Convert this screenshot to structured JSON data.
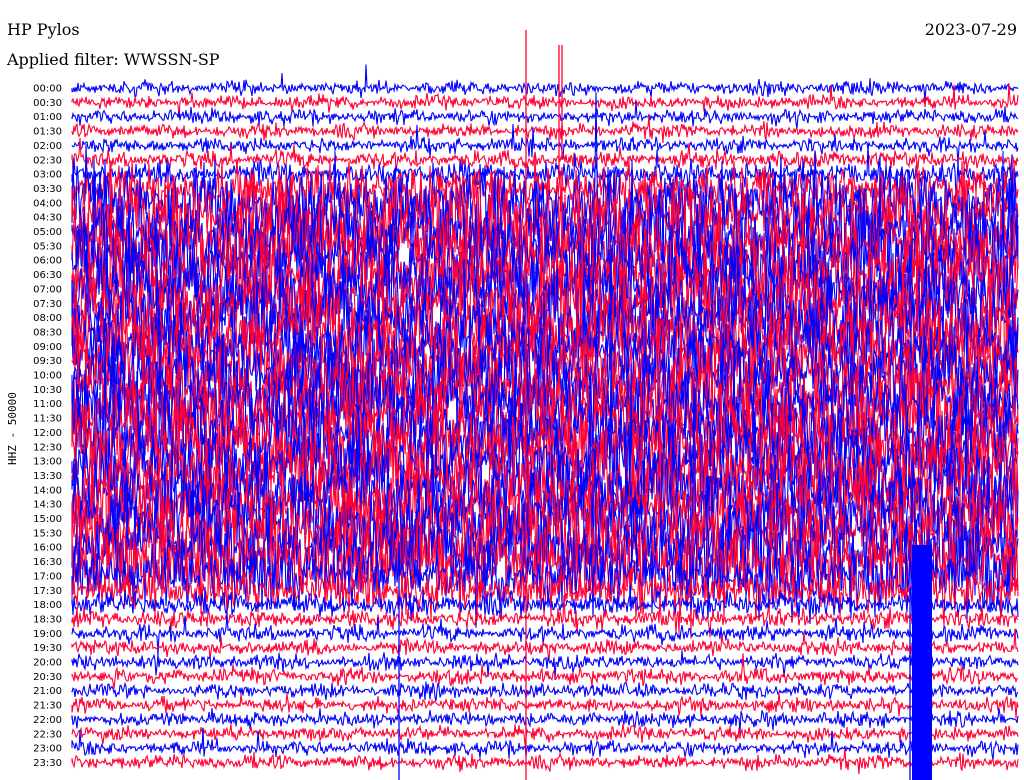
{
  "header": {
    "station": "HP Pylos",
    "filter": "Applied filter: WWSSN-SP",
    "date": "2023-07-29"
  },
  "colors": {
    "blue": "#0000ff",
    "red": "#ff0033"
  },
  "chart_data": {
    "type": "line",
    "title": "HP Pylos",
    "subtitle": "Applied filter: WWSSN-SP",
    "ylabel": "HHZ - 50000",
    "y_tick_labels": [
      "00:00",
      "00:30",
      "01:00",
      "01:30",
      "02:00",
      "02:30",
      "03:00",
      "03:30",
      "04:00",
      "04:30",
      "05:00",
      "05:30",
      "06:00",
      "06:30",
      "07:00",
      "07:30",
      "08:00",
      "08:30",
      "09:00",
      "09:30",
      "10:00",
      "10:30",
      "11:00",
      "11:30",
      "12:00",
      "12:30",
      "13:00",
      "13:30",
      "14:00",
      "14:30",
      "15:00",
      "15:30",
      "16:00",
      "16:30",
      "17:00",
      "17:30",
      "18:00",
      "18:30",
      "19:00",
      "19:30",
      "20:00",
      "20:30",
      "21:00",
      "21:30",
      "22:00",
      "22:30",
      "23:00",
      "23:30"
    ],
    "trace_colors": [
      "blue",
      "red"
    ],
    "grid": false,
    "legend": "none",
    "noise_profile": [
      0.12,
      0.12,
      0.13,
      0.13,
      0.14,
      0.16,
      0.25,
      0.55,
      0.85,
      1,
      1,
      1,
      1,
      1,
      1,
      1,
      1,
      1,
      1,
      1,
      1,
      1,
      1,
      1,
      1,
      1,
      1,
      1,
      1,
      1,
      1,
      1,
      1,
      0.95,
      0.8,
      0.5,
      0.25,
      0.18,
      0.15,
      0.14,
      0.14,
      0.14,
      0.13,
      0.13,
      0.13,
      0.13,
      0.13,
      0.13
    ]
  }
}
